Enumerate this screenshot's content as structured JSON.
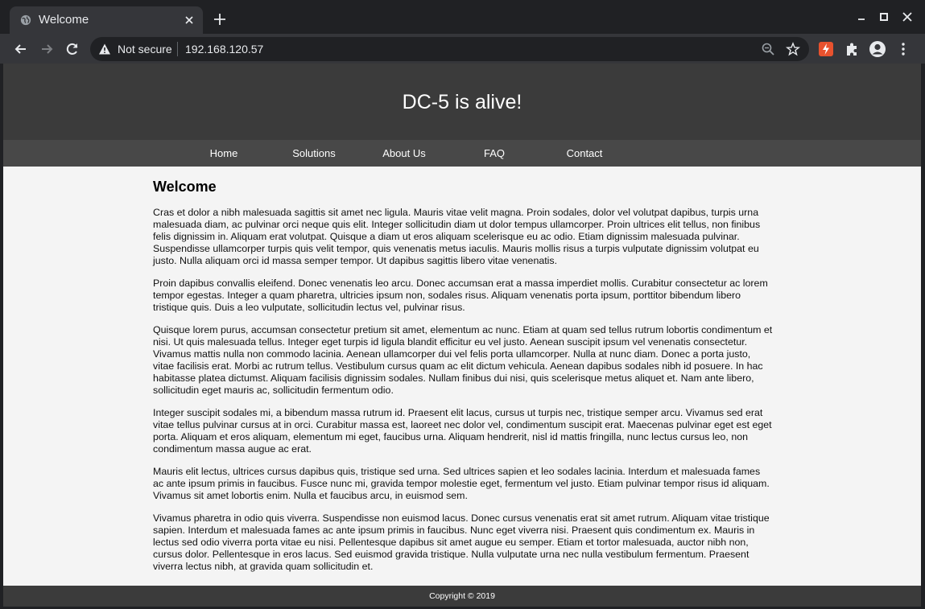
{
  "browser": {
    "tab_title": "Welcome",
    "security_label": "Not secure",
    "url": "192.168.120.57",
    "extension_color": "#e8522e"
  },
  "site": {
    "title": "DC-5 is alive!",
    "nav": [
      "Home",
      "Solutions",
      "About Us",
      "FAQ",
      "Contact"
    ],
    "heading": "Welcome",
    "paragraphs": [
      "Cras et dolor a nibh malesuada sagittis sit amet nec ligula. Mauris vitae velit magna. Proin sodales, dolor vel volutpat dapibus, turpis urna malesuada diam, ac pulvinar orci neque quis elit. Integer sollicitudin diam ut dolor tempus ullamcorper. Proin ultrices elit tellus, non finibus felis dignissim in. Aliquam erat volutpat. Quisque a diam ut eros aliquam scelerisque eu ac odio. Etiam dignissim malesuada pulvinar. Suspendisse ullamcorper turpis quis velit tempor, quis venenatis metus iaculis. Mauris mollis risus a turpis vulputate dignissim volutpat eu justo. Nulla aliquam orci id massa semper tempor. Ut dapibus sagittis libero vitae venenatis.",
      "Proin dapibus convallis eleifend. Donec venenatis leo arcu. Donec accumsan erat a massa imperdiet mollis. Curabitur consectetur ac lorem tempor egestas. Integer a quam pharetra, ultricies ipsum non, sodales risus. Aliquam venenatis porta ipsum, porttitor bibendum libero tristique quis. Duis a leo vulputate, sollicitudin lectus vel, pulvinar risus.",
      "Quisque lorem purus, accumsan consectetur pretium sit amet, elementum ac nunc. Etiam at quam sed tellus rutrum lobortis condimentum et nisi. Ut quis malesuada tellus. Integer eget turpis id ligula blandit efficitur eu vel justo. Aenean suscipit ipsum vel venenatis consectetur. Vivamus mattis nulla non commodo lacinia. Aenean ullamcorper dui vel felis porta ullamcorper. Nulla at nunc diam. Donec a porta justo, vitae facilisis erat. Morbi ac rutrum tellus. Vestibulum cursus quam ac elit dictum vehicula. Aenean dapibus sodales nibh id posuere. In hac habitasse platea dictumst. Aliquam facilisis dignissim sodales. Nullam finibus dui nisi, quis scelerisque metus aliquet et. Nam ante libero, sollicitudin eget mauris ac, sollicitudin fermentum odio.",
      "Integer suscipit sodales mi, a bibendum massa rutrum id. Praesent elit lacus, cursus ut turpis nec, tristique semper arcu. Vivamus sed erat vitae tellus pulvinar cursus at in orci. Curabitur massa est, laoreet nec dolor vel, condimentum suscipit erat. Maecenas pulvinar eget est eget porta. Aliquam et eros aliquam, elementum mi eget, faucibus urna. Aliquam hendrerit, nisl id mattis fringilla, nunc lectus cursus leo, non condimentum massa augue ac erat.",
      "Mauris elit lectus, ultrices cursus dapibus quis, tristique sed urna. Sed ultrices sapien et leo sodales lacinia. Interdum et malesuada fames ac ante ipsum primis in faucibus. Fusce nunc mi, gravida tempor molestie eget, fermentum vel justo. Etiam pulvinar tempor risus id aliquam. Vivamus sit amet lobortis enim. Nulla et faucibus arcu, in euismod sem.",
      "Vivamus pharetra in odio quis viverra. Suspendisse non euismod lacus. Donec cursus venenatis erat sit amet rutrum. Aliquam vitae tristique sapien. Interdum et malesuada fames ac ante ipsum primis in faucibus. Nunc eget viverra nisi. Praesent quis condimentum ex. Mauris in lectus sed odio viverra porta vitae eu nisi. Pellentesque dapibus sit amet augue eu semper. Etiam et tortor malesuada, auctor nibh non, cursus dolor. Pellentesque in eros lacus. Sed euismod gravida tristique. Nulla vulputate urna nec nulla vestibulum fermentum. Praesent viverra lectus nibh, at gravida quam sollicitudin et."
    ],
    "footer": "Copyright © 2019"
  }
}
